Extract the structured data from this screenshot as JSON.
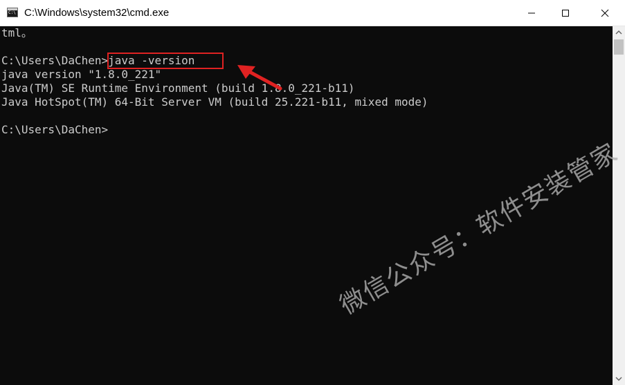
{
  "window": {
    "title": "C:\\Windows\\system32\\cmd.exe",
    "icon": "cmd-console-icon",
    "controls": {
      "minimize_icon": "minimize-icon",
      "maximize_icon": "maximize-icon",
      "close_icon": "close-icon"
    }
  },
  "console": {
    "lines": [
      "tml。",
      "",
      "C:\\Users\\DaChen>java -version",
      "java version \"1.8.0_221\"",
      "Java(TM) SE Runtime Environment (build 1.8.0_221-b11)",
      "Java HotSpot(TM) 64-Bit Server VM (build 25.221-b11, mixed mode)",
      "",
      "C:\\Users\\DaChen>"
    ],
    "text_color": "#cccccc",
    "background_color": "#0c0c0c"
  },
  "annotation": {
    "highlight_color": "#e02222"
  },
  "watermark": {
    "text": "微信公众号：软件安装管家"
  }
}
